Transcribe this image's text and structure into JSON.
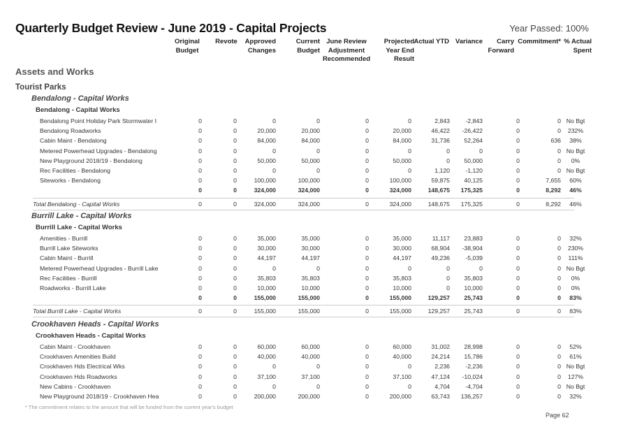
{
  "header": {
    "title": "Quarterly Budget Review - June 2019 - Capital Projects",
    "year_passed": "Year Passed: 100%"
  },
  "columns": [
    "Original\nBudget",
    "Revote",
    "Approved\nChanges",
    "Current\nBudget",
    "June Review\nAdjustment\nRecommended",
    "Projected\nYear End\nResult",
    "Actual YTD",
    "Variance",
    "Carry\nForward",
    "Commitment*",
    "% Actual\nSpent"
  ],
  "section": {
    "level1": "Assets and Works",
    "level2": "Tourist Parks"
  },
  "groups": [
    {
      "title": "Bendalong - Capital Works",
      "subtitle": "Bendalong - Capital Works",
      "rows": [
        {
          "name": "Bendalong Point Holiday Park Stormwater I",
          "values": [
            "0",
            "0",
            "0",
            "0",
            "0",
            "0",
            "2,843",
            "-2,843",
            "0",
            "0",
            "No Bgt"
          ]
        },
        {
          "name": "Bendalong Roadworks",
          "values": [
            "0",
            "0",
            "20,000",
            "20,000",
            "0",
            "20,000",
            "46,422",
            "-26,422",
            "0",
            "0",
            "232%"
          ]
        },
        {
          "name": "Cabin Maint - Bendalong",
          "values": [
            "0",
            "0",
            "84,000",
            "84,000",
            "0",
            "84,000",
            "31,736",
            "52,264",
            "0",
            "636",
            "38%"
          ]
        },
        {
          "name": "Metered Powerhead Upgrades - Bendalong",
          "values": [
            "0",
            "0",
            "0",
            "0",
            "0",
            "0",
            "0",
            "0",
            "0",
            "0",
            "No Bgt"
          ]
        },
        {
          "name": "New Playground 2018/19 - Bendalong",
          "values": [
            "0",
            "0",
            "50,000",
            "50,000",
            "0",
            "50,000",
            "0",
            "50,000",
            "0",
            "0",
            "0%"
          ]
        },
        {
          "name": "Rec Facilities - Bendalong",
          "values": [
            "0",
            "0",
            "0",
            "0",
            "0",
            "0",
            "1,120",
            "-1,120",
            "0",
            "0",
            "No Bgt"
          ]
        },
        {
          "name": "Siteworks - Bendalong",
          "values": [
            "0",
            "0",
            "100,000",
            "100,000",
            "0",
            "100,000",
            "59,875",
            "40,125",
            "0",
            "7,655",
            "60%"
          ]
        }
      ],
      "subtotal": [
        "0",
        "0",
        "324,000",
        "324,000",
        "0",
        "324,000",
        "148,675",
        "175,325",
        "0",
        "8,292",
        "46%"
      ],
      "total": {
        "name": "Total Bendalong - Capital Works",
        "values": [
          "0",
          "0",
          "324,000",
          "324,000",
          "0",
          "324,000",
          "148,675",
          "175,325",
          "0",
          "8,292",
          "46%"
        ]
      }
    },
    {
      "title": "Burrill Lake - Capital Works",
      "subtitle": "Burrill Lake - Capital Works",
      "rows": [
        {
          "name": "Amenities - Burrill",
          "values": [
            "0",
            "0",
            "35,000",
            "35,000",
            "0",
            "35,000",
            "11,117",
            "23,883",
            "0",
            "0",
            "32%"
          ]
        },
        {
          "name": "Burrill Lake Siteworks",
          "values": [
            "0",
            "0",
            "30,000",
            "30,000",
            "0",
            "30,000",
            "68,904",
            "-38,904",
            "0",
            "0",
            "230%"
          ]
        },
        {
          "name": "Cabin Maint - Burrill",
          "values": [
            "0",
            "0",
            "44,197",
            "44,197",
            "0",
            "44,197",
            "49,236",
            "-5,039",
            "0",
            "0",
            "111%"
          ]
        },
        {
          "name": "Metered Powerhead Upgrades - Burrill Lake",
          "values": [
            "0",
            "0",
            "0",
            "0",
            "0",
            "0",
            "0",
            "0",
            "0",
            "0",
            "No Bgt"
          ]
        },
        {
          "name": "Rec Facilities - Burrill",
          "values": [
            "0",
            "0",
            "35,803",
            "35,803",
            "0",
            "35,803",
            "0",
            "35,803",
            "0",
            "0",
            "0%"
          ]
        },
        {
          "name": "Roadworks - Burrill Lake",
          "values": [
            "0",
            "0",
            "10,000",
            "10,000",
            "0",
            "10,000",
            "0",
            "10,000",
            "0",
            "0",
            "0%"
          ]
        }
      ],
      "subtotal": [
        "0",
        "0",
        "155,000",
        "155,000",
        "0",
        "155,000",
        "129,257",
        "25,743",
        "0",
        "0",
        "83%"
      ],
      "total": {
        "name": "Total Burrill Lake - Capital Works",
        "values": [
          "0",
          "0",
          "155,000",
          "155,000",
          "0",
          "155,000",
          "129,257",
          "25,743",
          "0",
          "0",
          "83%"
        ]
      }
    },
    {
      "title": "Crookhaven Heads - Capital Works",
      "subtitle": "Crookhaven Heads - Capital Works",
      "rows": [
        {
          "name": "Cabin Maint - Crookhaven",
          "values": [
            "0",
            "0",
            "60,000",
            "60,000",
            "0",
            "60,000",
            "31,002",
            "28,998",
            "0",
            "0",
            "52%"
          ]
        },
        {
          "name": "Crookhaven Amenities Build",
          "values": [
            "0",
            "0",
            "40,000",
            "40,000",
            "0",
            "40,000",
            "24,214",
            "15,786",
            "0",
            "0",
            "61%"
          ]
        },
        {
          "name": "Crookhaven Hds Electrical Wks",
          "values": [
            "0",
            "0",
            "0",
            "0",
            "0",
            "0",
            "2,236",
            "-2,236",
            "0",
            "0",
            "No Bgt"
          ]
        },
        {
          "name": "Crookhaven Hds Roadworks",
          "values": [
            "0",
            "0",
            "37,100",
            "37,100",
            "0",
            "37,100",
            "47,124",
            "-10,024",
            "0",
            "0",
            "127%"
          ]
        },
        {
          "name": "New Cabins - Crookhaven",
          "values": [
            "0",
            "0",
            "0",
            "0",
            "0",
            "0",
            "4,704",
            "-4,704",
            "0",
            "0",
            "No Bgt"
          ]
        },
        {
          "name": "New Playground 2018/19 - Crookhaven Hea",
          "values": [
            "0",
            "0",
            "200,000",
            "200,000",
            "0",
            "200,000",
            "63,743",
            "136,257",
            "0",
            "0",
            "32%"
          ]
        }
      ]
    }
  ],
  "footer": {
    "footnote": "* The commitment relates to the amount that will be funded from the current year's budget",
    "page": "Page 62"
  }
}
